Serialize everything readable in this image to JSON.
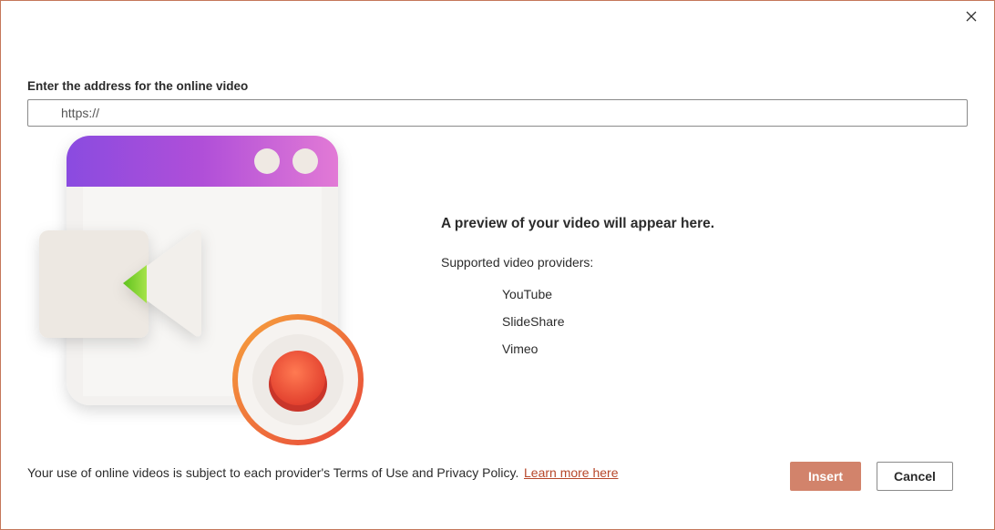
{
  "dialog": {
    "close_icon": "close-icon",
    "url_label": "Enter the address for the online video",
    "url_placeholder": "https://",
    "url_value": "",
    "illustration_icon": "video-player-illustration"
  },
  "preview": {
    "title": "A preview of your video will appear here.",
    "providers_label": "Supported video providers:",
    "providers": [
      "YouTube",
      "SlideShare",
      "Vimeo"
    ]
  },
  "footer": {
    "terms_text": "Your use of online videos is subject to each provider's Terms of Use and Privacy Policy.",
    "learn_more_label": "Learn more here",
    "insert_label": "Insert",
    "cancel_label": "Cancel"
  },
  "colors": {
    "accent": "#d2836b",
    "border": "#c5775a",
    "link": "#b7472a"
  }
}
